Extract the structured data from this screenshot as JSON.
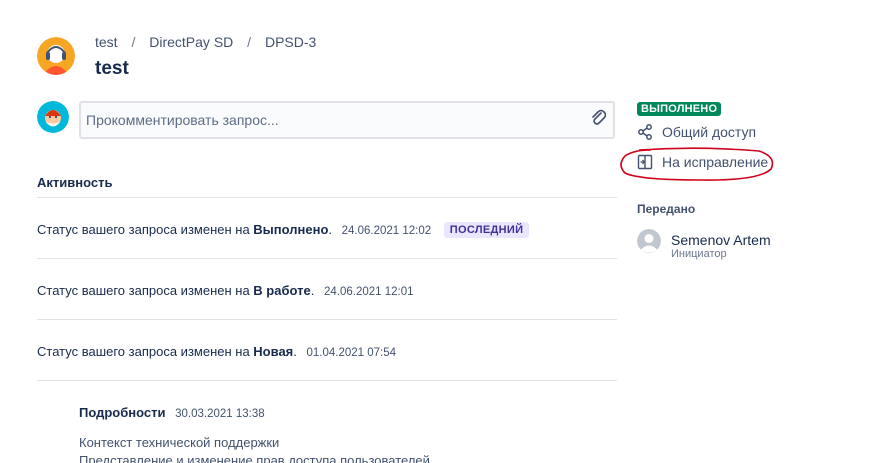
{
  "breadcrumb": {
    "items": [
      "test",
      "DirectPay SD",
      "DPSD-3"
    ],
    "separator": "/"
  },
  "request": {
    "title": "test"
  },
  "comment": {
    "placeholder": "Прокомментировать запрос...",
    "attach_icon": "paperclip-icon"
  },
  "activity": {
    "title": "Активность",
    "events": [
      {
        "text": "Статус вашего запроса изменен на ",
        "status": "Выполнено",
        "timestamp": "24.06.2021 12:02",
        "badge": "ПОСЛЕДНИЙ"
      },
      {
        "text": "Статус вашего запроса изменен на ",
        "status": "В работе",
        "timestamp": "24.06.2021 12:01"
      },
      {
        "text": "Статус вашего запроса изменен на ",
        "status": "Новая",
        "timestamp": "01.04.2021 07:54"
      }
    ],
    "details": {
      "title": "Подробности",
      "timestamp": "30.03.2021 13:38",
      "lines": [
        "Контекст технической поддержки",
        "Представление и изменение прав доступа пользователей"
      ]
    }
  },
  "sidebar": {
    "status": "ВЫПОЛНЕНО",
    "status_color": "#00875a",
    "share_label": "Общий доступ",
    "reopen_label": "На исправление",
    "annotation_color": "#d0021b",
    "transferred_label": "Передано",
    "assignee": {
      "name": "Semenov Artem",
      "role": "Инициатор"
    }
  }
}
